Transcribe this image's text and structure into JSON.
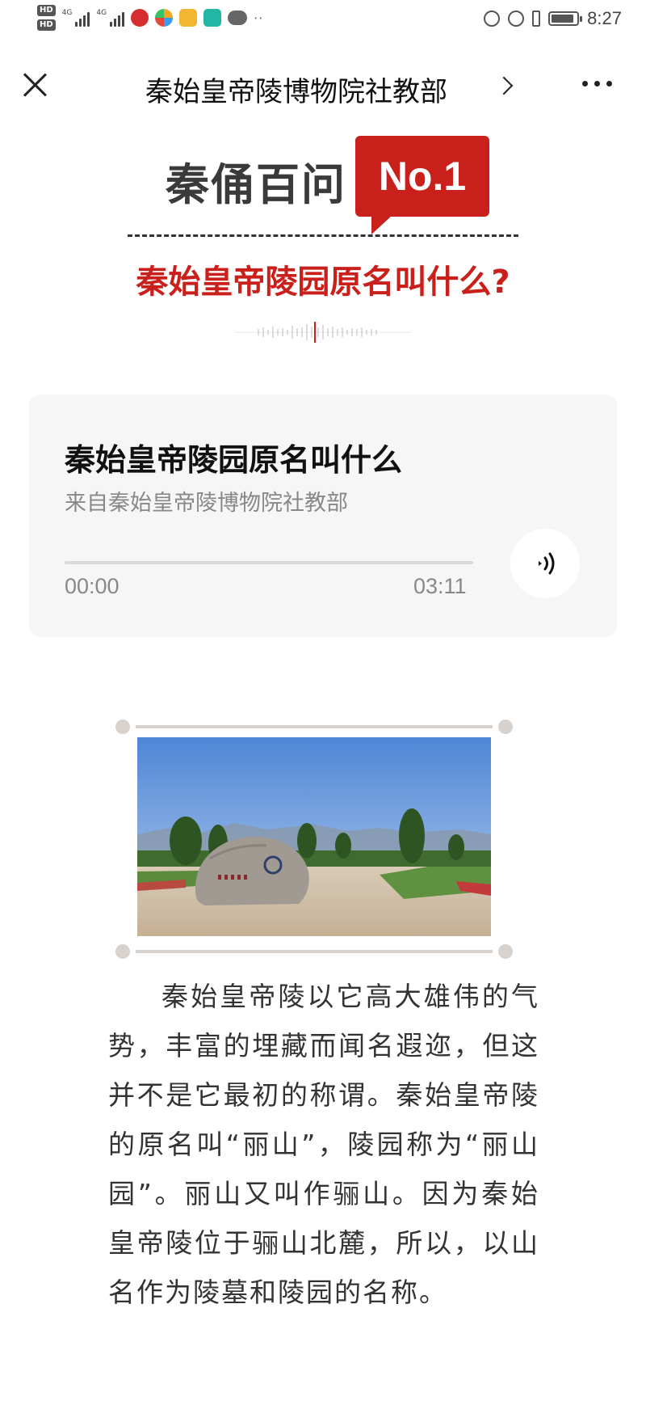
{
  "status_bar": {
    "hd_labels": [
      "HD",
      "HD"
    ],
    "network_labels": [
      "4G",
      "4G"
    ],
    "more_indicator": "··",
    "time": "8:27",
    "battery_level": 0.9,
    "icons": [
      "hd-icon",
      "signal-icon",
      "app-icon",
      "message-icon",
      "wechat-icon",
      "data-saver-icon",
      "alarm-icon",
      "vibrate-icon",
      "battery-icon"
    ]
  },
  "title_bar": {
    "title": "秦始皇帝陵博物院社教部",
    "close_icon": "close-icon",
    "chevron_icon": "chevron-right-icon",
    "more_icon": "more-dots-icon"
  },
  "header": {
    "series_title": "秦俑百问",
    "badge": "No.1",
    "question": "秦始皇帝陵园原名叫什么?"
  },
  "audio": {
    "title": "秦始皇帝陵园原名叫什么",
    "source": "来自秦始皇帝陵博物院社教部",
    "current_time": "00:00",
    "total_time": "03:11",
    "progress": 0,
    "play_icon": "sound-wave-icon"
  },
  "photo": {
    "alt_icon": "photo-stone-monument"
  },
  "article": {
    "paragraph": "秦始皇帝陵以它高大雄伟的气势，丰富的埋藏而闻名遐迩，但这并不是它最初的称谓。秦始皇帝陵的原名叫“丽山”，陵园称为“丽山园”。丽山又叫作骊山。因为秦始皇帝陵位于骊山北麓，所以，以山名作为陵墓和陵园的名称。"
  },
  "colors": {
    "accent_red": "#c9201b",
    "card_bg": "#f6f6f6",
    "frame": "#d8d2cf"
  }
}
